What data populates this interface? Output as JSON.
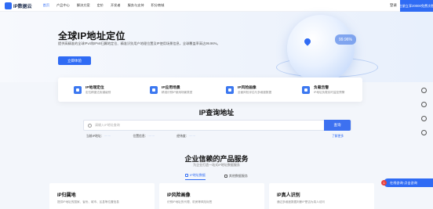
{
  "nav": {
    "logo_text": "IP数据云",
    "items": [
      "首页",
      "产品中心",
      "解决方案",
      "定价",
      "开发者",
      "服务与支持",
      "积分商城"
    ],
    "login_label": "登录",
    "signup_label": "注册立享20000免费次数"
  },
  "hero": {
    "title": "全球IP地址定位",
    "description": "提供高精准的全球IPv4和IPv6归属地定位、精准识别用户地理位置及IP使用场景信息，全球覆盖率高达99.96%。",
    "button_label": "立即体验",
    "badge": "99.96%"
  },
  "features": [
    {
      "title": "IP地理定位",
      "sub": "定位精度达街道级别"
    },
    {
      "title": "IP应用场景",
      "sub": "精准识别IP使用场景类型"
    },
    {
      "title": "IP风险画像",
      "sub": "全面风险评估与多维度数据"
    },
    {
      "title": "负载告警",
      "sub": "IP地址负载实时监控预警"
    }
  ],
  "query": {
    "title": "IP查询地址",
    "placeholder": "请输入IP地址查询",
    "button_label": "查询",
    "info": [
      {
        "label": "当前IP地址：",
        "value": "·······"
      },
      {
        "label": "位置信息：",
        "value": "·······"
      },
      {
        "label": "经纬度：",
        "value": "·······"
      }
    ],
    "more_label": "了解更多"
  },
  "services": {
    "title": "企业信赖的产品服务",
    "subtitle": "为企业打造一站式IP地址数据服务",
    "tabs": [
      "IP地址数据",
      "其他数据服务"
    ],
    "cards": [
      {
        "title": "IP归属地",
        "desc": "提供IP地址的国家、省份、城市、区县等位置信息"
      },
      {
        "title": "IP风险画像",
        "desc": "识别IP地址的代理、机房等风险标签"
      },
      {
        "title": "IP真人识别",
        "desc": "通过多维度数据判断IP是否为真人访问"
      }
    ]
  },
  "consult": {
    "badge": "1",
    "label": "在线咨询·点击咨询"
  },
  "colors": {
    "accent": "#2f6bf4",
    "badge_red": "#e8423f"
  }
}
